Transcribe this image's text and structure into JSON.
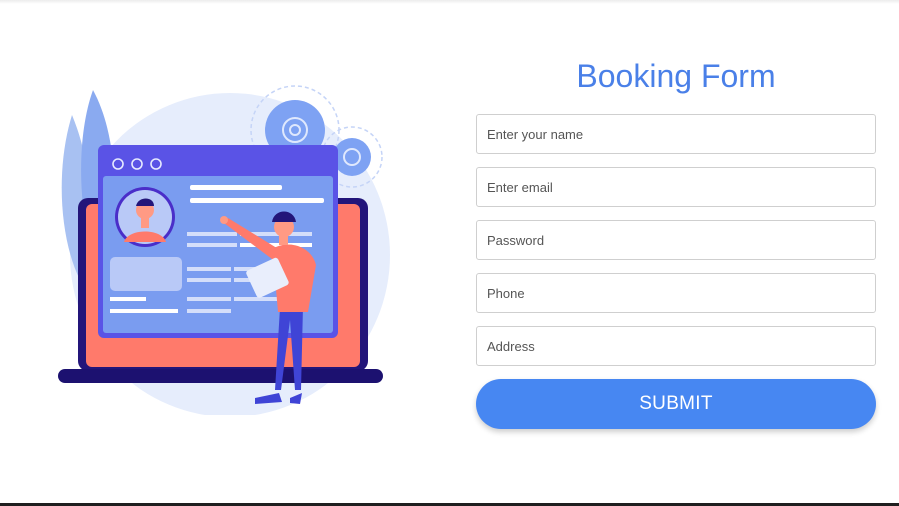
{
  "form": {
    "title": "Booking Form",
    "name_placeholder": "Enter your name",
    "email_placeholder": "Enter email",
    "password_placeholder": "Password",
    "phone_placeholder": "Phone",
    "address_placeholder": "Address",
    "submit_label": "SUBMIT"
  },
  "colors": {
    "accent": "#4787f2",
    "title": "#4a80e8",
    "laptop_coral": "#ff7a6b",
    "laptop_navy": "#23157a",
    "screen_purple": "#5a53e6"
  },
  "illustration": {
    "icon": "booking-illustration"
  }
}
